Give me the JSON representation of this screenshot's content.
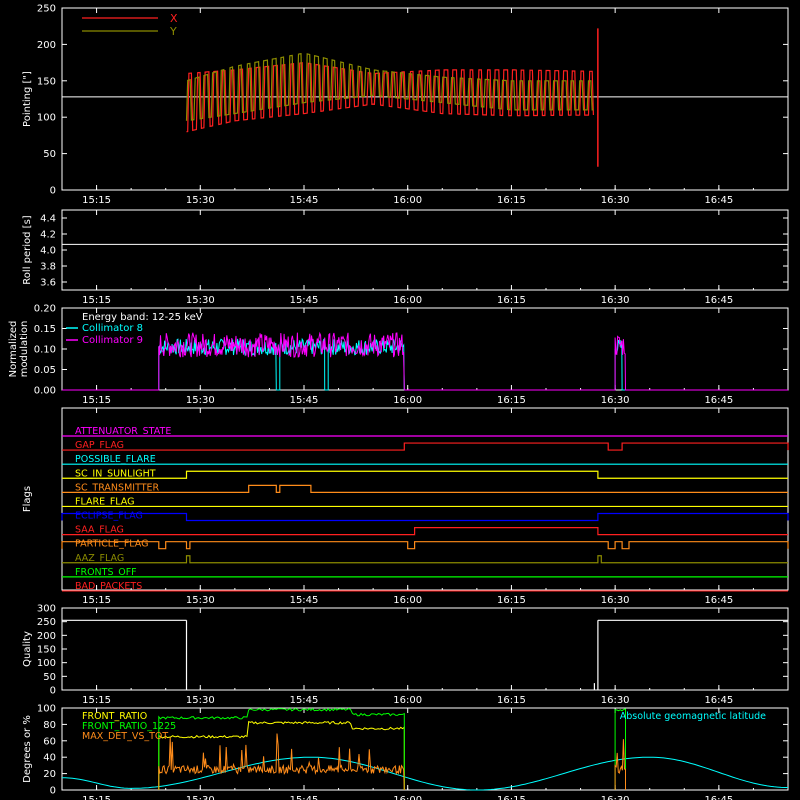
{
  "time_axis": {
    "xlim": [
      "15:10",
      "16:55"
    ],
    "tick_labels": [
      "15:15",
      "15:30",
      "15:45",
      "16:00",
      "16:15",
      "16:30",
      "16:45"
    ],
    "tick_minutes": [
      305,
      320,
      335,
      350,
      365,
      380,
      395
    ]
  },
  "colors": {
    "background": "#000000",
    "axes": "#ffffff",
    "red": "#ff2020",
    "olive": "#8b8b00",
    "cyan": "#00ffff",
    "magenta": "#ff00ff",
    "yellow": "#ffff00",
    "orange": "#ff8c1a",
    "green": "#00ff00",
    "blue": "#0000ff",
    "lightgreen": "#66ff66"
  },
  "chart_data": [
    {
      "id": "pointing",
      "type": "line",
      "ylabel": "Pointing [\"]",
      "ylim": [
        0,
        250
      ],
      "yticks": [
        0,
        50,
        100,
        150,
        200,
        250
      ],
      "legend": [
        "X",
        "Y"
      ],
      "legend_placement": "top-left",
      "reference_line": 128,
      "data_window": [
        "15:28",
        "16:28"
      ],
      "series": [
        {
          "name": "X",
          "color": "red",
          "x": [
            "15:28",
            "15:35",
            "15:45",
            "15:55",
            "16:05",
            "16:15",
            "16:27"
          ],
          "upper": [
            160,
            165,
            175,
            160,
            165,
            165,
            163
          ],
          "lower": [
            80,
            95,
            105,
            118,
            105,
            102,
            103
          ],
          "spikes": [
            {
              "x": "16:27.5",
              "low": 32,
              "high": 222
            }
          ]
        },
        {
          "name": "Y",
          "color": "olive",
          "x": [
            "15:28",
            "15:35",
            "15:45",
            "15:55",
            "16:05",
            "16:15",
            "16:27"
          ],
          "upper": [
            150,
            170,
            188,
            165,
            155,
            150,
            150
          ],
          "lower": [
            95,
            105,
            120,
            130,
            120,
            110,
            110
          ]
        }
      ]
    },
    {
      "id": "roll_period",
      "type": "line",
      "ylabel": "Roll period [s]",
      "ylim": [
        3.5,
        4.5
      ],
      "yticks": [
        3.6,
        3.8,
        4.0,
        4.2,
        4.4
      ],
      "series": [
        {
          "x": [
            "15:10",
            "16:55"
          ],
          "y": [
            4.07,
            4.07
          ],
          "color": "axes"
        }
      ]
    },
    {
      "id": "modulation",
      "type": "line",
      "ylabel": [
        "Normalized",
        "modulation"
      ],
      "ylim": [
        0,
        0.2
      ],
      "yticks": [
        "0.00",
        "0.05",
        "0.10",
        "0.15",
        "0.20"
      ],
      "annotation": "Energy band: 12-25 keV",
      "legend": [
        "Collimator 8",
        "Collimator 9"
      ],
      "legend_placement": "top-left",
      "series": [
        {
          "name": "Collimator 8",
          "color": "cyan",
          "segments": [
            [
              "15:24",
              "15:41"
            ],
            [
              "15:41.5",
              "15:48"
            ],
            [
              "15:48.5",
              "15:59.5"
            ],
            [
              "16:30",
              "16:31"
            ]
          ],
          "level": 0.105,
          "noise": 0.02
        },
        {
          "name": "Collimator 9",
          "color": "magenta",
          "segments": [
            [
              "15:24",
              "15:59.5"
            ],
            [
              "16:30",
              "16:31.5"
            ]
          ],
          "level": 0.11,
          "noise": 0.03
        }
      ]
    },
    {
      "id": "flags",
      "type": "line",
      "ylabel": "Flags",
      "flags": [
        {
          "name": "ATTENUATOR_STATE",
          "color": "magenta",
          "transitions": []
        },
        {
          "name": "GAP_FLAG",
          "color": "red",
          "transitions": [
            [
              "15:59.5",
              "16:29"
            ],
            [
              "16:31",
              "16:55"
            ]
          ]
        },
        {
          "name": "POSSIBLE_FLARE",
          "color": "cyan",
          "transitions": []
        },
        {
          "name": "SC_IN_SUNLIGHT",
          "color": "yellow",
          "transitions": [
            [
              "15:28",
              "16:27.5"
            ]
          ]
        },
        {
          "name": "SC_TRANSMITTER",
          "color": "orange",
          "transitions": [
            [
              "15:37",
              "15:41"
            ],
            [
              "15:41.5",
              "15:46"
            ]
          ]
        },
        {
          "name": "FLARE_FLAG",
          "color": "yellow",
          "transitions": []
        },
        {
          "name": "ECLIPSE_FLAG",
          "color": "blue",
          "transitions": [
            [
              "15:10",
              "15:28"
            ],
            [
              "16:27.5",
              "16:55"
            ]
          ]
        },
        {
          "name": "SAA_FLAG",
          "color": "red",
          "transitions": [
            [
              "16:01",
              "16:27.5"
            ]
          ]
        },
        {
          "name": "PARTICLE_FLAG",
          "color": "orange",
          "transitions": [
            [
              "15:10",
              "15:24"
            ],
            [
              "15:25",
              "15:28"
            ],
            [
              "15:28.5",
              "16:00"
            ],
            [
              "16:01",
              "16:29"
            ],
            [
              "16:30",
              "16:31"
            ],
            [
              "16:32",
              "16:55"
            ]
          ]
        },
        {
          "name": "AAZ_FLAG",
          "color": "olive",
          "transitions": [
            [
              "15:28",
              "15:28.5"
            ],
            [
              "16:27.5",
              "16:28"
            ]
          ]
        },
        {
          "name": "FRONTS_OFF",
          "color": "green",
          "transitions": []
        },
        {
          "name": "BAD_PACKETS",
          "color": "red",
          "transitions": []
        }
      ]
    },
    {
      "id": "quality",
      "type": "line",
      "ylabel": "Quality",
      "ylim": [
        0,
        300
      ],
      "yticks": [
        0,
        50,
        100,
        150,
        200,
        250,
        300
      ],
      "series": [
        {
          "color": "axes",
          "high": 255,
          "segments": [
            [
              "15:10",
              "15:28"
            ],
            [
              "16:27.5",
              "16:55"
            ]
          ],
          "spike": {
            "x": "16:27",
            "y": 25
          }
        }
      ]
    },
    {
      "id": "latitude",
      "type": "line",
      "ylabel": "Degrees or %",
      "ylim": [
        0,
        100
      ],
      "yticks": [
        0,
        20,
        40,
        60,
        80,
        100
      ],
      "legend": [
        "FRONT_RATIO",
        "FRONT_RATIO_1225",
        "MAX_DET_VS_TOT"
      ],
      "legend_placement": "top-left",
      "label_right": "Absolute geomagnetic latitude",
      "series": [
        {
          "name": "Absolute geomagnetic latitude",
          "color": "cyan",
          "x": [
            "15:10",
            "15:20",
            "15:46",
            "16:10",
            "16:35",
            "16:55"
          ],
          "y": [
            15,
            2,
            40,
            0,
            40,
            3
          ]
        },
        {
          "name": "FRONT_RATIO",
          "color": "yellow",
          "segments": [
            [
              "15:24",
              "15:59.5"
            ]
          ],
          "levels": [
            {
              "x": [
                "15:24",
                "15:37"
              ],
              "y": 65
            },
            {
              "x": [
                "15:37",
                "15:52"
              ],
              "y": 82
            },
            {
              "x": [
                "15:52",
                "15:59.5"
              ],
              "y": 75
            }
          ]
        },
        {
          "name": "FRONT_RATIO_1225",
          "color": "green",
          "segments": [
            [
              "15:24",
              "15:59.5"
            ],
            [
              "16:30",
              "16:31.5"
            ]
          ],
          "levels": [
            {
              "x": [
                "15:24",
                "15:37"
              ],
              "y": 88
            },
            {
              "x": [
                "15:37",
                "15:52"
              ],
              "y": 98
            },
            {
              "x": [
                "15:52",
                "15:59.5"
              ],
              "y": 92
            }
          ]
        },
        {
          "name": "MAX_DET_VS_TOT",
          "color": "orange",
          "segments": [
            [
              "15:24",
              "15:59.5"
            ],
            [
              "16:30",
              "16:31.5"
            ]
          ],
          "level": 25,
          "noise": 40
        }
      ]
    }
  ]
}
